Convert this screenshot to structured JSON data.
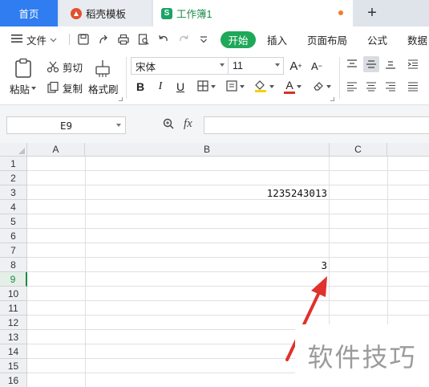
{
  "tabs": {
    "home": "首页",
    "daoke": "稻壳模板",
    "workbook": "工作簿1",
    "workbook_icon": "S",
    "new_tab": "+"
  },
  "menu": {
    "file": "文件",
    "start": "开始",
    "insert": "插入",
    "page_layout": "页面布局",
    "formulas": "公式",
    "data": "数据"
  },
  "ribbon": {
    "paste": "粘贴",
    "cut": "剪切",
    "copy": "复制",
    "format_painter": "格式刷",
    "font_name": "宋体",
    "font_size": "11",
    "bold": "B",
    "italic": "I",
    "underline": "U",
    "font_color_glyph": "A",
    "grow_font": "A",
    "shrink_font": "A"
  },
  "formula_bar": {
    "name_box": "E9",
    "fx": "fx",
    "formula": ""
  },
  "sheet": {
    "columns": [
      "A",
      "B",
      "C"
    ],
    "rows": [
      "1",
      "2",
      "3",
      "4",
      "5",
      "6",
      "7",
      "8",
      "9",
      "10",
      "11",
      "12",
      "13",
      "14",
      "15",
      "16"
    ],
    "active_row": "9",
    "cells": {
      "B3": "1235243013",
      "B8": "3"
    }
  },
  "watermark": "软件技巧",
  "colors": {
    "accent_blue": "#2f7df0",
    "start_green": "#1fa85a",
    "arrow_red": "#e0312d",
    "font_color_red": "#d9302a",
    "fill_yellow": "#f5d200"
  },
  "icons": {
    "tab_daoke": "daoke-logo-icon",
    "tab_workbook": "spreadsheet-icon",
    "menu": "hamburger-icon"
  }
}
